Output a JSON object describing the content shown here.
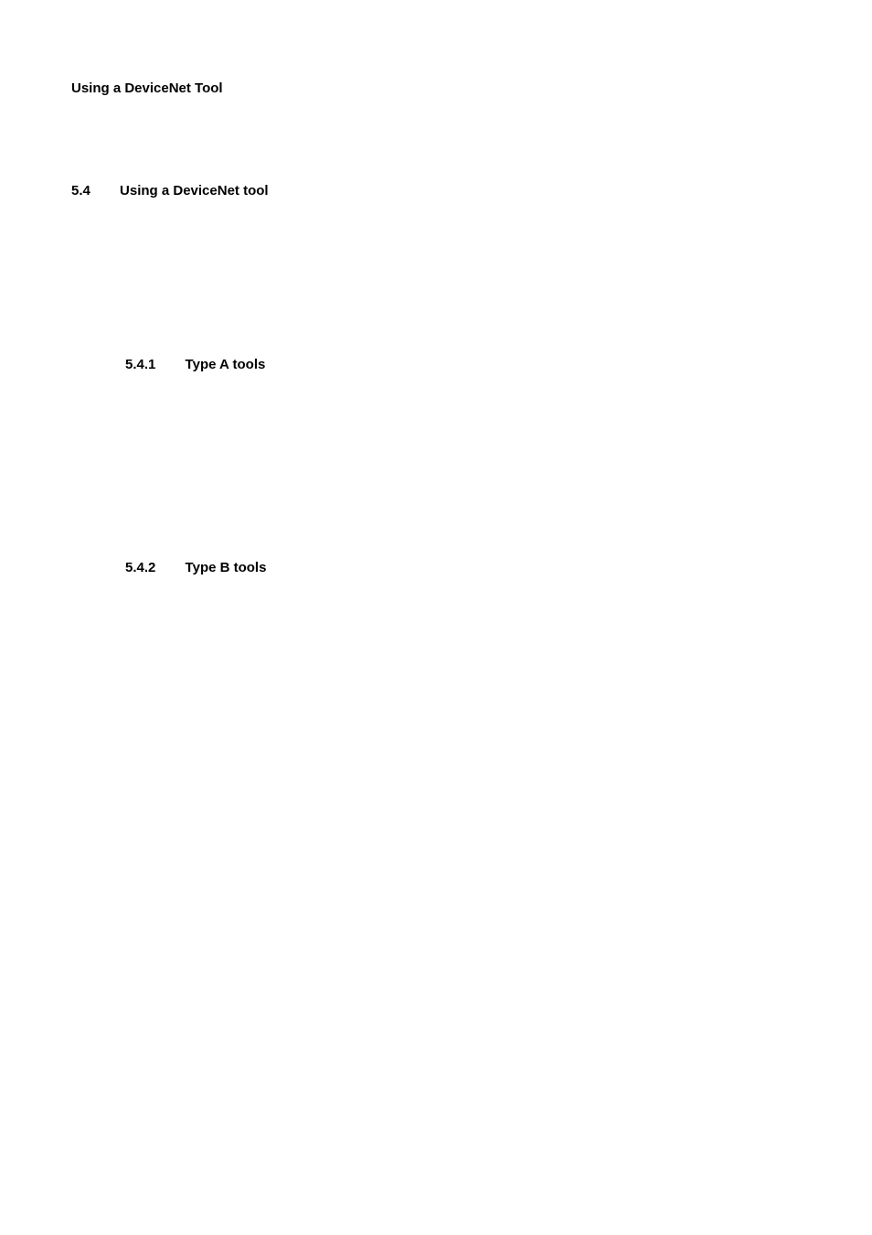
{
  "header": {
    "text": "Using a DeviceNet Tool"
  },
  "section": {
    "number": "5.4",
    "title": "Using a DeviceNet tool"
  },
  "subsection1": {
    "number": "5.4.1",
    "title": "Type A tools"
  },
  "subsection2": {
    "number": "5.4.2",
    "title": "Type B tools"
  }
}
